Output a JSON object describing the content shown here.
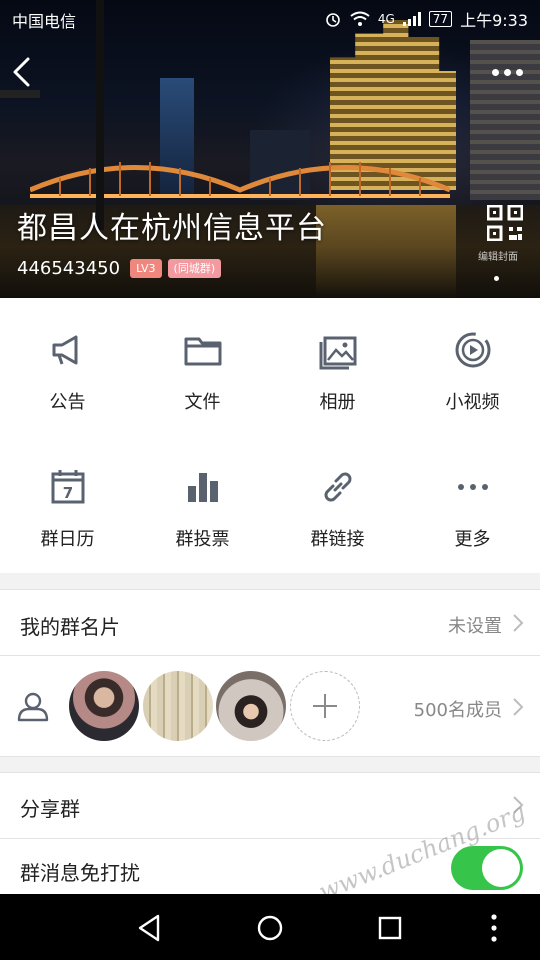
{
  "status_bar": {
    "carrier": "中国电信",
    "network": "4G",
    "battery": "77",
    "time": "上午9:33"
  },
  "header": {
    "group_name": "都昌人在杭州信息平台",
    "group_id": "446543450",
    "level_badge": "LV3",
    "type_badge": "(同城群)",
    "qr_caption": "编辑封面",
    "icons": {
      "back": "back-arrow-icon",
      "more": "more-dots-icon",
      "qr": "qr-code-icon"
    }
  },
  "functions": [
    {
      "label": "公告",
      "icon": "megaphone-icon"
    },
    {
      "label": "文件",
      "icon": "folder-icon"
    },
    {
      "label": "相册",
      "icon": "photo-album-icon"
    },
    {
      "label": "小视频",
      "icon": "video-icon"
    },
    {
      "label": "群日历",
      "icon": "calendar-icon"
    },
    {
      "label": "群投票",
      "icon": "bar-chart-icon"
    },
    {
      "label": "群链接",
      "icon": "link-icon"
    },
    {
      "label": "更多",
      "icon": "more-horizontal-icon"
    }
  ],
  "calendar_day": "7",
  "card": {
    "label": "我的群名片",
    "value": "未设置"
  },
  "members": {
    "count_label": "500名成员"
  },
  "share": {
    "label": "分享群"
  },
  "mute": {
    "label": "群消息免打扰",
    "on": true
  },
  "watermark": "www.duchang.org",
  "colors": {
    "accent_green": "#36c54a",
    "badge": "#f0877f",
    "icon_gray": "#5a6270"
  }
}
